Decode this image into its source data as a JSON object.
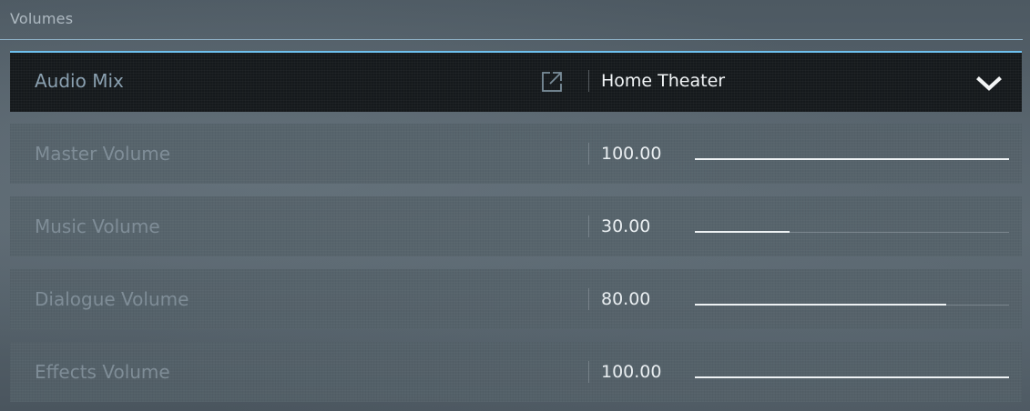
{
  "section": {
    "title": "Volumes"
  },
  "audio_mix": {
    "label": "Audio Mix",
    "selected_value": "Home Theater",
    "link_icon": "external-link-icon",
    "dropdown_icon": "chevron-down-icon"
  },
  "sliders": [
    {
      "label": "Master Volume",
      "value": "100.00",
      "percent": 100
    },
    {
      "label": "Music Volume",
      "value": "30.00",
      "percent": 30
    },
    {
      "label": "Dialogue Volume",
      "value": "80.00",
      "percent": 80
    },
    {
      "label": "Effects Volume",
      "value": "100.00",
      "percent": 100
    }
  ],
  "colors": {
    "accent": "#6ec1ef",
    "active_row_bg": "#15191c",
    "slider_fill": "#eef2f4"
  }
}
